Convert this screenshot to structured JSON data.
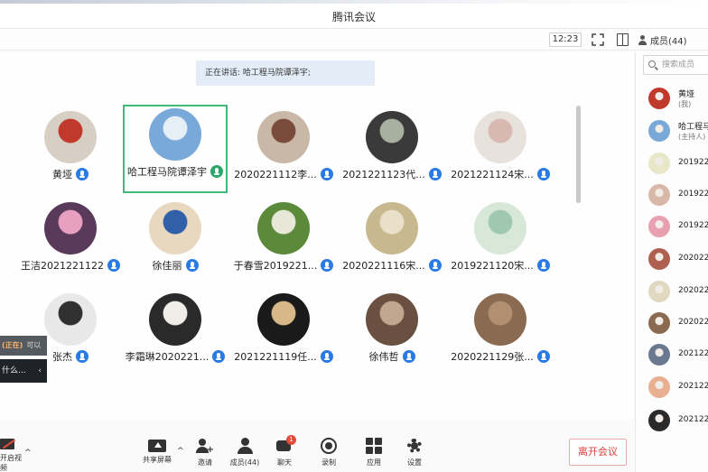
{
  "window": {
    "title": "腾讯会议"
  },
  "toolbar": {
    "clock": "12:23",
    "members_tab": "成员(44)"
  },
  "speaking_banner": "正在讲话: 哈工程马院谭泽宇;",
  "tiles": [
    {
      "name": "黄垭",
      "color_a": "#d8cfc4",
      "color_b": "#c0392b"
    },
    {
      "name": "哈工程马院谭泽宇",
      "color_a": "#79a9d8",
      "color_b": "#e6eef6",
      "active": true
    },
    {
      "name": "2020221112李...",
      "color_a": "#c9b8a8",
      "color_b": "#7a4a3a"
    },
    {
      "name": "2021221123代...",
      "color_a": "#3a3a3a",
      "color_b": "#a8b0a0"
    },
    {
      "name": "2021221124宋...",
      "color_a": "#e8e2dc",
      "color_b": "#d8b8b0"
    },
    {
      "name": "王洁2021221122",
      "color_a": "#5a3a5a",
      "color_b": "#e8a0c0"
    },
    {
      "name": "徐佳丽",
      "color_a": "#e8d8c0",
      "color_b": "#3060a8"
    },
    {
      "name": "于春雪2019221...",
      "color_a": "#5a8a3a",
      "color_b": "#e8e8d8"
    },
    {
      "name": "2020221116宋...",
      "color_a": "#c8b890",
      "color_b": "#e8e0c8"
    },
    {
      "name": "2019221120宋...",
      "color_a": "#d8e8d8",
      "color_b": "#a0c8b0"
    },
    {
      "name": "张杰",
      "color_a": "#e8e8e8",
      "color_b": "#303030"
    },
    {
      "name": "李霜琳2020221...",
      "color_a": "#2a2a2a",
      "color_b": "#f0ece8"
    },
    {
      "name": "2021221119任...",
      "color_a": "#1a1a1a",
      "color_b": "#d8b888"
    },
    {
      "name": "徐伟哲",
      "color_a": "#6a5040",
      "color_b": "#c0a890"
    },
    {
      "name": "2020221129张...",
      "color_a": "#8a6a50",
      "color_b": "#b09070"
    }
  ],
  "popup": {
    "top_text": "(正在)",
    "top_sub": "可以",
    "bottom_text": "什么...",
    "chevron": "‹"
  },
  "controls": {
    "video": "开启视频",
    "share": "共享屏幕",
    "invite": "邀请",
    "members": "成员(44)",
    "chat": "聊天",
    "chat_badge": "1",
    "record": "录制",
    "apps": "应用",
    "settings": "设置",
    "leave": "离开会议",
    "caret": "^"
  },
  "panel": {
    "search_placeholder": "搜索成员",
    "members": [
      {
        "name": "黄垭",
        "sub": "(我)",
        "color": "#c0392b"
      },
      {
        "name": "哈工程马",
        "sub": "(主持人)",
        "color": "#79a9d8"
      },
      {
        "name": "201922",
        "color": "#e8e8c8"
      },
      {
        "name": "201922",
        "color": "#d8b8a8"
      },
      {
        "name": "201922",
        "color": "#e8a0b0"
      },
      {
        "name": "202022",
        "color": "#b06050"
      },
      {
        "name": "202022",
        "color": "#e0d8c0"
      },
      {
        "name": "202022",
        "color": "#8a6a50"
      },
      {
        "name": "202122",
        "color": "#6a7890"
      },
      {
        "name": "202122",
        "color": "#e8b090"
      },
      {
        "name": "202122",
        "color": "#2a2a2a"
      }
    ]
  }
}
